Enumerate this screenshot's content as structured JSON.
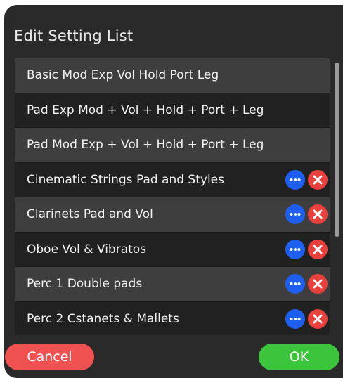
{
  "dialog": {
    "title": "Edit Setting List"
  },
  "list": {
    "items": [
      {
        "label": "Basic Mod Exp Vol Hold Port Leg",
        "has_actions": false
      },
      {
        "label": "Pad Exp Mod + Vol + Hold + Port + Leg",
        "has_actions": false
      },
      {
        "label": "Pad Mod Exp + Vol + Hold + Port + Leg",
        "has_actions": false
      },
      {
        "label": "Cinematic Strings Pad and Styles",
        "has_actions": true
      },
      {
        "label": "Clarinets Pad and Vol",
        "has_actions": true
      },
      {
        "label": "Oboe Vol & Vibratos",
        "has_actions": true
      },
      {
        "label": "Perc 1 Double pads",
        "has_actions": true
      },
      {
        "label": "Perc 2 Cstanets & Mallets",
        "has_actions": true
      }
    ]
  },
  "footer": {
    "cancel_label": "Cancel",
    "ok_label": "OK"
  },
  "icons": {
    "more": "ellipsis-icon",
    "delete": "close-icon"
  },
  "colors": {
    "dialog_bg": "#2a2a2a",
    "row_odd": "#3e3e3e",
    "row_even": "#212121",
    "more_button": "#1f5ff0",
    "delete_button": "#e8403c",
    "cancel_button": "#f05252",
    "ok_button": "#3cc43c"
  }
}
